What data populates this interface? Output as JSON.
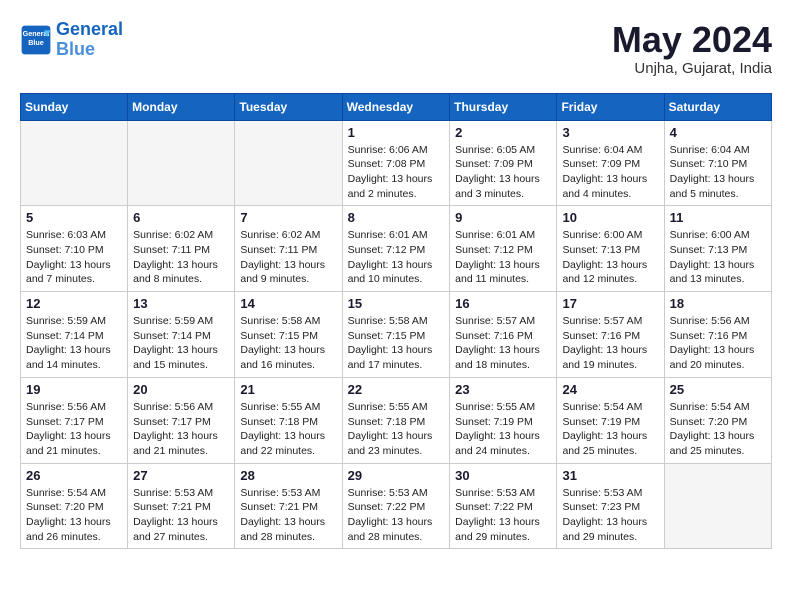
{
  "header": {
    "logo_line1": "General",
    "logo_line2": "Blue",
    "month": "May 2024",
    "location": "Unjha, Gujarat, India"
  },
  "weekdays": [
    "Sunday",
    "Monday",
    "Tuesday",
    "Wednesday",
    "Thursday",
    "Friday",
    "Saturday"
  ],
  "weeks": [
    [
      {
        "day": "",
        "info": ""
      },
      {
        "day": "",
        "info": ""
      },
      {
        "day": "",
        "info": ""
      },
      {
        "day": "1",
        "info": "Sunrise: 6:06 AM\nSunset: 7:08 PM\nDaylight: 13 hours and 2 minutes."
      },
      {
        "day": "2",
        "info": "Sunrise: 6:05 AM\nSunset: 7:09 PM\nDaylight: 13 hours and 3 minutes."
      },
      {
        "day": "3",
        "info": "Sunrise: 6:04 AM\nSunset: 7:09 PM\nDaylight: 13 hours and 4 minutes."
      },
      {
        "day": "4",
        "info": "Sunrise: 6:04 AM\nSunset: 7:10 PM\nDaylight: 13 hours and 5 minutes."
      }
    ],
    [
      {
        "day": "5",
        "info": "Sunrise: 6:03 AM\nSunset: 7:10 PM\nDaylight: 13 hours and 7 minutes."
      },
      {
        "day": "6",
        "info": "Sunrise: 6:02 AM\nSunset: 7:11 PM\nDaylight: 13 hours and 8 minutes."
      },
      {
        "day": "7",
        "info": "Sunrise: 6:02 AM\nSunset: 7:11 PM\nDaylight: 13 hours and 9 minutes."
      },
      {
        "day": "8",
        "info": "Sunrise: 6:01 AM\nSunset: 7:12 PM\nDaylight: 13 hours and 10 minutes."
      },
      {
        "day": "9",
        "info": "Sunrise: 6:01 AM\nSunset: 7:12 PM\nDaylight: 13 hours and 11 minutes."
      },
      {
        "day": "10",
        "info": "Sunrise: 6:00 AM\nSunset: 7:13 PM\nDaylight: 13 hours and 12 minutes."
      },
      {
        "day": "11",
        "info": "Sunrise: 6:00 AM\nSunset: 7:13 PM\nDaylight: 13 hours and 13 minutes."
      }
    ],
    [
      {
        "day": "12",
        "info": "Sunrise: 5:59 AM\nSunset: 7:14 PM\nDaylight: 13 hours and 14 minutes."
      },
      {
        "day": "13",
        "info": "Sunrise: 5:59 AM\nSunset: 7:14 PM\nDaylight: 13 hours and 15 minutes."
      },
      {
        "day": "14",
        "info": "Sunrise: 5:58 AM\nSunset: 7:15 PM\nDaylight: 13 hours and 16 minutes."
      },
      {
        "day": "15",
        "info": "Sunrise: 5:58 AM\nSunset: 7:15 PM\nDaylight: 13 hours and 17 minutes."
      },
      {
        "day": "16",
        "info": "Sunrise: 5:57 AM\nSunset: 7:16 PM\nDaylight: 13 hours and 18 minutes."
      },
      {
        "day": "17",
        "info": "Sunrise: 5:57 AM\nSunset: 7:16 PM\nDaylight: 13 hours and 19 minutes."
      },
      {
        "day": "18",
        "info": "Sunrise: 5:56 AM\nSunset: 7:16 PM\nDaylight: 13 hours and 20 minutes."
      }
    ],
    [
      {
        "day": "19",
        "info": "Sunrise: 5:56 AM\nSunset: 7:17 PM\nDaylight: 13 hours and 21 minutes."
      },
      {
        "day": "20",
        "info": "Sunrise: 5:56 AM\nSunset: 7:17 PM\nDaylight: 13 hours and 21 minutes."
      },
      {
        "day": "21",
        "info": "Sunrise: 5:55 AM\nSunset: 7:18 PM\nDaylight: 13 hours and 22 minutes."
      },
      {
        "day": "22",
        "info": "Sunrise: 5:55 AM\nSunset: 7:18 PM\nDaylight: 13 hours and 23 minutes."
      },
      {
        "day": "23",
        "info": "Sunrise: 5:55 AM\nSunset: 7:19 PM\nDaylight: 13 hours and 24 minutes."
      },
      {
        "day": "24",
        "info": "Sunrise: 5:54 AM\nSunset: 7:19 PM\nDaylight: 13 hours and 25 minutes."
      },
      {
        "day": "25",
        "info": "Sunrise: 5:54 AM\nSunset: 7:20 PM\nDaylight: 13 hours and 25 minutes."
      }
    ],
    [
      {
        "day": "26",
        "info": "Sunrise: 5:54 AM\nSunset: 7:20 PM\nDaylight: 13 hours and 26 minutes."
      },
      {
        "day": "27",
        "info": "Sunrise: 5:53 AM\nSunset: 7:21 PM\nDaylight: 13 hours and 27 minutes."
      },
      {
        "day": "28",
        "info": "Sunrise: 5:53 AM\nSunset: 7:21 PM\nDaylight: 13 hours and 28 minutes."
      },
      {
        "day": "29",
        "info": "Sunrise: 5:53 AM\nSunset: 7:22 PM\nDaylight: 13 hours and 28 minutes."
      },
      {
        "day": "30",
        "info": "Sunrise: 5:53 AM\nSunset: 7:22 PM\nDaylight: 13 hours and 29 minutes."
      },
      {
        "day": "31",
        "info": "Sunrise: 5:53 AM\nSunset: 7:23 PM\nDaylight: 13 hours and 29 minutes."
      },
      {
        "day": "",
        "info": ""
      }
    ]
  ]
}
